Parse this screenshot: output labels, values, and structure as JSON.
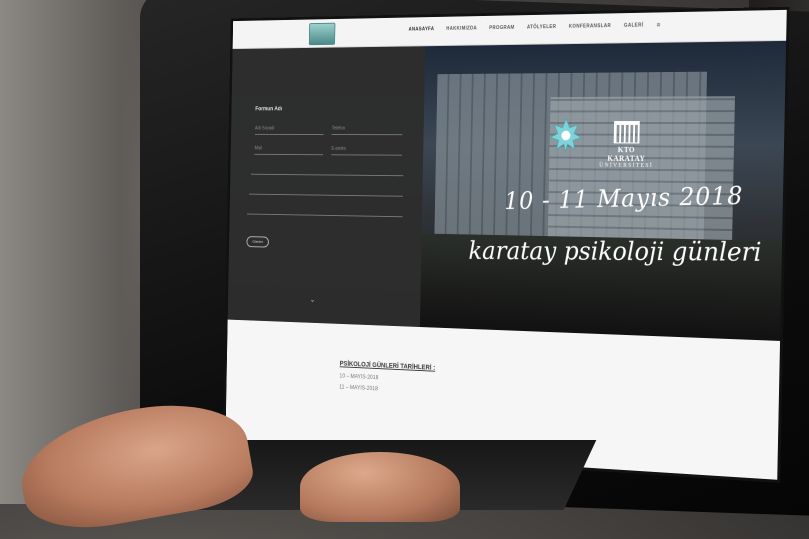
{
  "nav": {
    "items": [
      "ANASAYFA",
      "HAKKIMIZDA",
      "PROGRAM",
      "ATÖLYELER",
      "KONFERANSLAR",
      "GALERİ"
    ],
    "menu_icon": "hamburger-icon"
  },
  "form": {
    "title": "Formun Adı",
    "fields": [
      "Adı Soyadı",
      "Telefon",
      "Mail",
      "E-posta",
      "",
      "",
      ""
    ],
    "submit_label": "Gönder"
  },
  "hero": {
    "date": "10 - 11 Mayıs 2018",
    "title": "karatay psikoloji günleri",
    "university_name": "KTO KARATAY",
    "university_sub": "ÜNİVERSİTESİ"
  },
  "dates": {
    "heading": "PSİKOLOJİ GÜNLERİ TARİHLERİ :",
    "lines": [
      "10 – MAYIS-2018",
      "11 – MAYIS-2018"
    ]
  }
}
